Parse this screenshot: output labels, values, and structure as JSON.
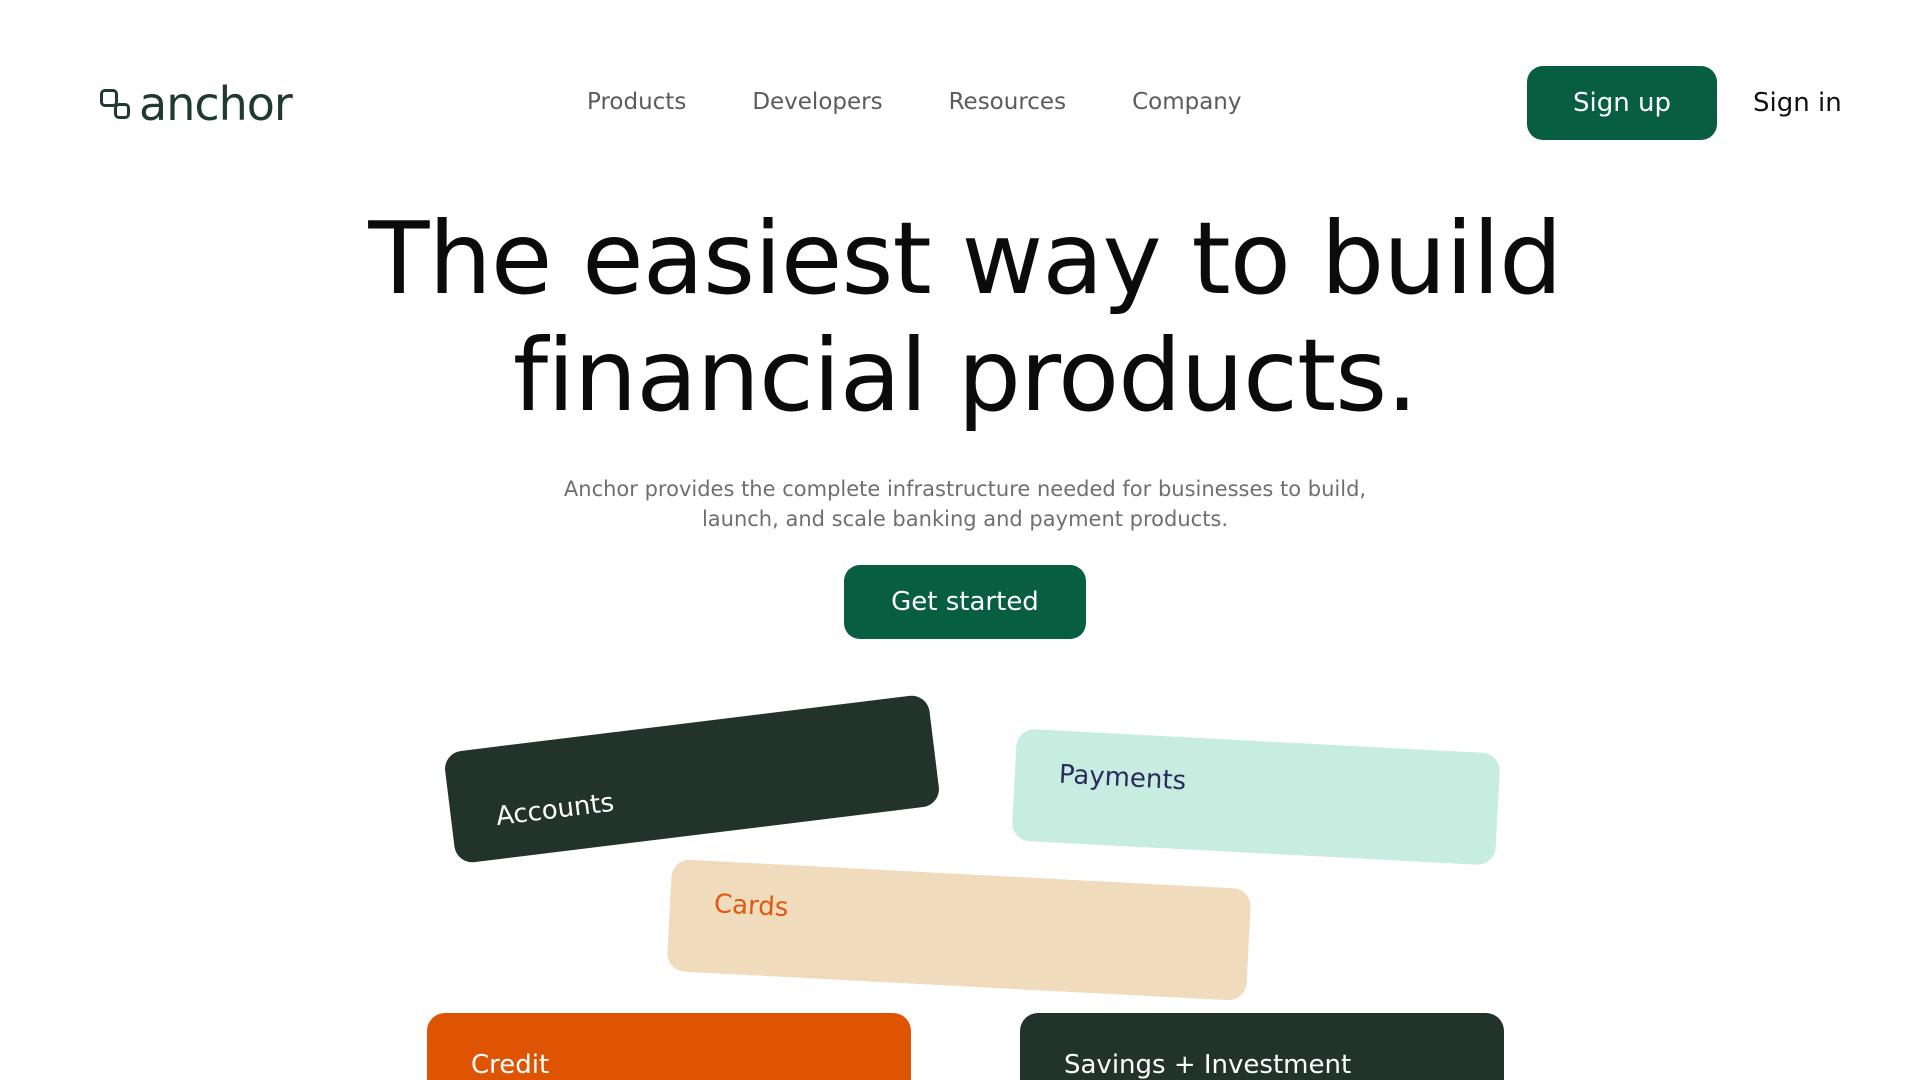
{
  "brand": {
    "name": "anchor",
    "logo_icon": "anchor-logo-icon",
    "primary_color": "#075e40",
    "text_color": "#1f3a2e"
  },
  "nav": {
    "items": [
      {
        "label": "Products"
      },
      {
        "label": "Developers"
      },
      {
        "label": "Resources"
      },
      {
        "label": "Company"
      }
    ]
  },
  "header": {
    "signup_label": "Sign up",
    "signin_label": "Sign in"
  },
  "hero": {
    "title_line1": "The easiest way to build",
    "title_line2": "financial products.",
    "subtitle_line1": "Anchor provides the complete infrastructure needed for businesses to build,",
    "subtitle_line2": "launch, and scale banking and payment products.",
    "cta_label": "Get started"
  },
  "products": {
    "cards": [
      {
        "label": "Accounts",
        "bg": "#22332c",
        "fg": "#ffffff"
      },
      {
        "label": "Payments",
        "bg": "#c6ede0",
        "fg": "#2d2b5e"
      },
      {
        "label": "Cards",
        "bg": "#f1dbbd",
        "fg": "#dd5a0e"
      },
      {
        "label": "Credit",
        "bg": "#df5402",
        "fg": "#ffffff"
      },
      {
        "label": "Savings + Investment",
        "bg": "#22332c",
        "fg": "#ffffff"
      }
    ]
  }
}
